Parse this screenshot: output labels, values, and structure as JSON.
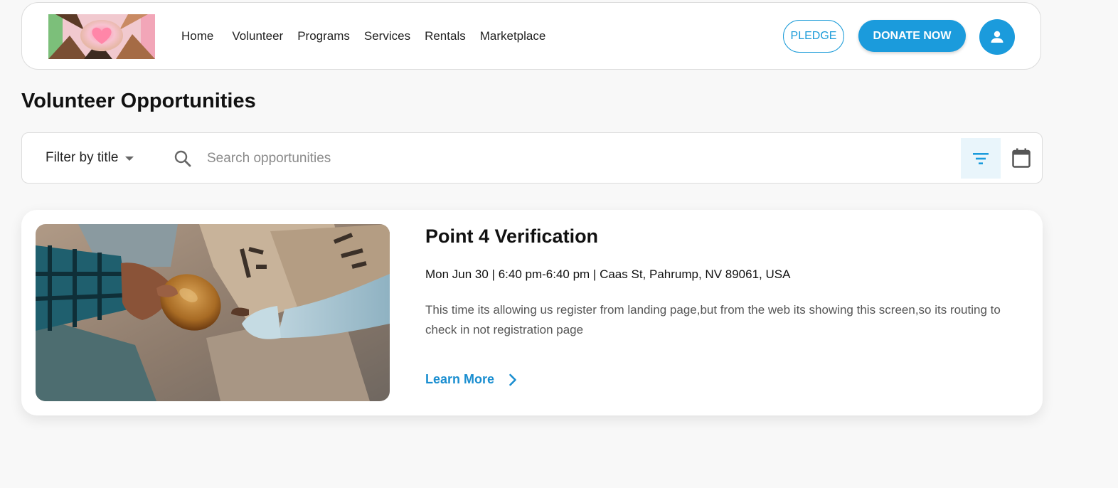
{
  "header": {
    "nav": [
      {
        "label": "Home"
      },
      {
        "label": "Volunteer"
      },
      {
        "label": "Programs"
      },
      {
        "label": "Services"
      },
      {
        "label": "Rentals"
      },
      {
        "label": "Marketplace"
      }
    ],
    "pledge_label": "PLEDGE",
    "donate_label": "DONATE NOW",
    "avatar_icon": "person-icon"
  },
  "page": {
    "title": "Volunteer Opportunities"
  },
  "filter": {
    "select_label": "Filter by title",
    "search_placeholder": "Search opportunities",
    "search_value": "",
    "filter_icon": "filter-icon",
    "calendar_icon": "calendar-icon"
  },
  "opportunities": [
    {
      "title": "Point 4 Verification",
      "meta": "Mon Jun 30 | 6:40 pm-6:40 pm | Caas St, Pahrump, NV 89061, USA",
      "description": "This time its allowing us register from landing page,but from the web its showing this screen,so its routing to check in not registration page",
      "cta": "Learn More"
    }
  ],
  "colors": {
    "accent": "#1b9bdc",
    "background": "#f8f8f8",
    "card": "#ffffff",
    "filter_active_bg": "#e9f5fb"
  }
}
